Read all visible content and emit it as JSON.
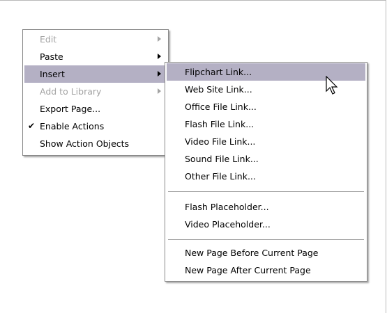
{
  "context_menu": {
    "items": [
      {
        "label": "Edit",
        "enabled": false,
        "submenu": true
      },
      {
        "label": "Paste",
        "enabled": true,
        "submenu": true
      },
      {
        "label": "Insert",
        "enabled": true,
        "submenu": true,
        "highlighted": true
      },
      {
        "label": "Add to Library",
        "enabled": false,
        "submenu": true
      },
      {
        "label": "Export Page...",
        "enabled": true
      },
      {
        "label": "Enable Actions",
        "enabled": true,
        "checked": true
      },
      {
        "label": "Show Action Objects",
        "enabled": true
      }
    ]
  },
  "insert_submenu": {
    "items": [
      {
        "label": "Flipchart Link...",
        "highlighted": true
      },
      {
        "label": "Web Site Link..."
      },
      {
        "label": "Office File Link..."
      },
      {
        "label": "Flash File Link..."
      },
      {
        "label": "Video File Link..."
      },
      {
        "label": "Sound File Link..."
      },
      {
        "label": "Other File Link..."
      },
      {
        "label": "Flash Placeholder..."
      },
      {
        "label": "Video Placeholder..."
      },
      {
        "label": "New Page Before Current Page"
      },
      {
        "label": "New Page After Current Page"
      }
    ]
  },
  "icons": {
    "check": "checkmark-icon",
    "submenu_arrow": "chevron-right-icon",
    "pointer": "mouse-pointer-icon"
  },
  "colors": {
    "highlight": "#b4b0c4",
    "disabled_text": "#a3a3a3",
    "menu_border": "#8a8a8a"
  }
}
